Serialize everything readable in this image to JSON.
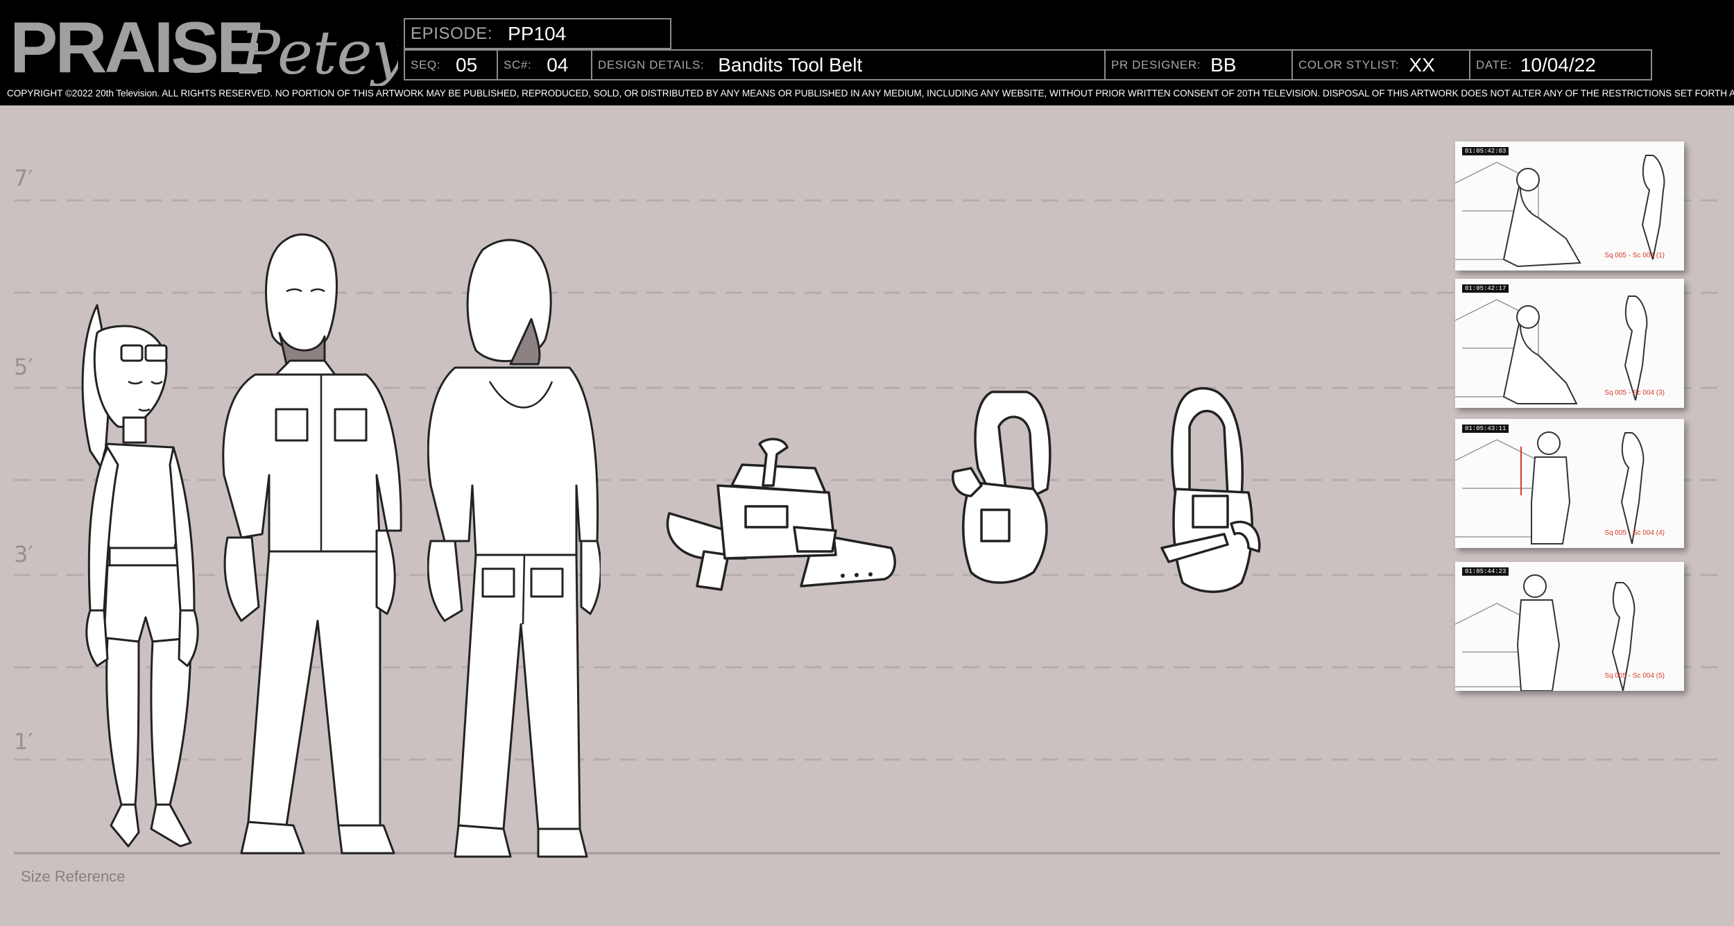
{
  "header": {
    "logo_word1": "PRAISE",
    "logo_word2": "Petey",
    "episode_label": "EPISODE:",
    "episode": "PP104",
    "seq_label": "SEQ:",
    "seq": "05",
    "sc_label": "SC#:",
    "sc": "04",
    "design_label": "DESIGN DETAILS:",
    "design": "Bandits Tool Belt",
    "designer_label": "PR DESIGNER:",
    "designer": "BB",
    "stylist_label": "COLOR STYLIST:",
    "stylist": "XX",
    "date_label": "DATE:",
    "date": "10/04/22",
    "copyright": "COPYRIGHT ©2022 20th Television. ALL RIGHTS RESERVED. NO PORTION OF THIS ARTWORK MAY BE PUBLISHED, REPRODUCED, SOLD, OR DISTRIBUTED BY ANY MEANS OR PUBLISHED IN ANY MEDIUM, INCLUDING ANY WEBSITE, WITHOUT PRIOR WRITTEN CONSENT OF 20TH TELEVISION. DISPOSAL OF THIS ARTWORK DOES NOT ALTER ANY OF THE RESTRICTIONS SET FORTH ABOVE."
  },
  "height_ticks": [
    "7′",
    "5′",
    "3′",
    "1′"
  ],
  "size_reference": "Size Reference",
  "thumbnails": [
    {
      "timecode": "01:05:42:03",
      "caption": "Sq 005 - Sc 004 (1)"
    },
    {
      "timecode": "01:05:42:17",
      "caption": "Sq 005 - Sc 004 (3)"
    },
    {
      "timecode": "01:05:43:11",
      "caption": "Sq 005 - Sc 004 (4)"
    },
    {
      "timecode": "01:05:44:23",
      "caption": "Sq 005 - Sc 004 (5)"
    }
  ],
  "colors": {
    "header_bg": "#000000",
    "page_bg": "#cbc1c1",
    "caption_red": "#d73a2a"
  }
}
